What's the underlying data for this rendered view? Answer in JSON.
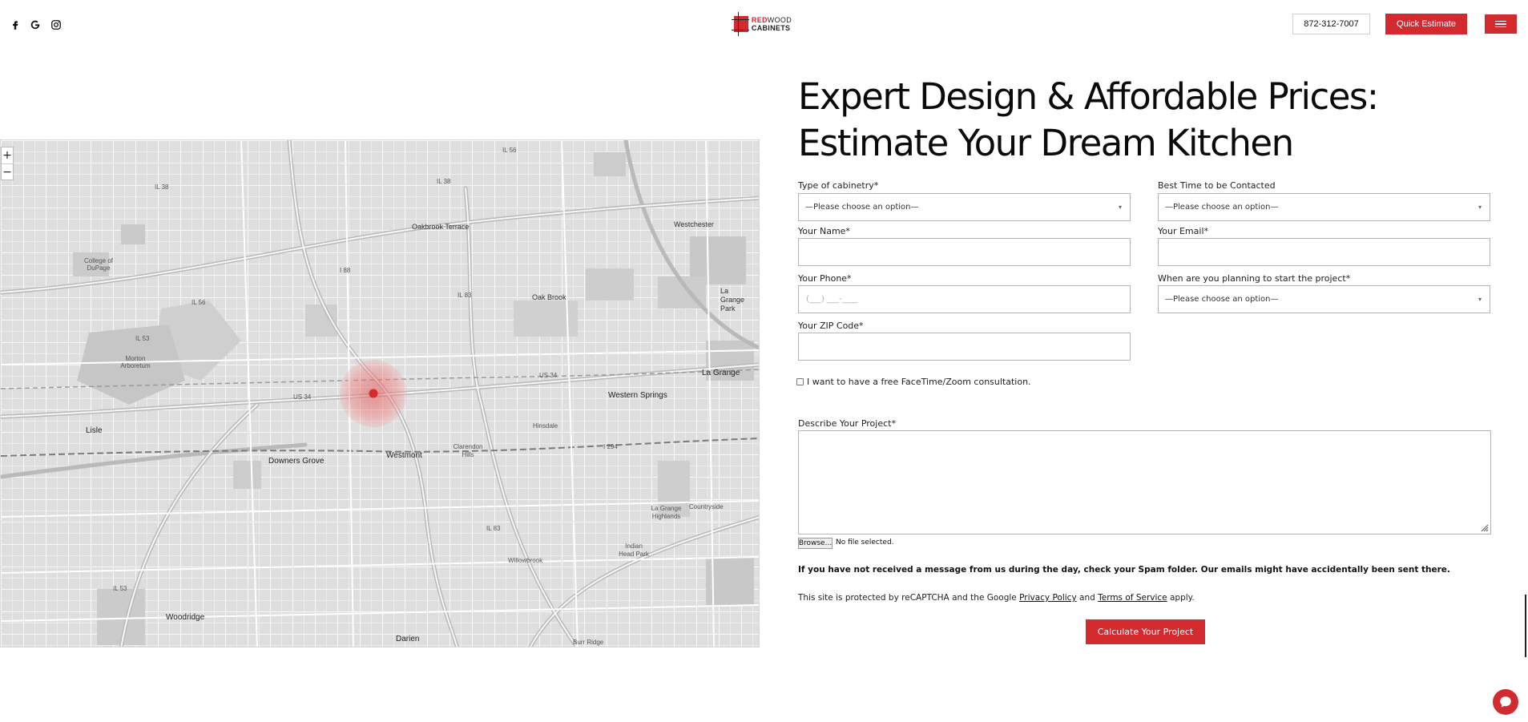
{
  "header": {
    "social_icons": [
      "facebook-icon",
      "google-icon",
      "instagram-icon"
    ],
    "logo": {
      "line1_red": "RED",
      "line1_rest": "WOOD",
      "line2": "CABINETS"
    },
    "phone": "872-312-7007",
    "quick_estimate_label": "Quick Estimate",
    "menu_icon": "hamburger-icon"
  },
  "map": {
    "zoom_in": "+",
    "zoom_out": "−",
    "labels": {
      "oakbrook_terrace": "Oakbrook Terrace",
      "westchester": "Westchester",
      "college_dupage": "College of DuPage",
      "oak_brook": "Oak Brook",
      "la_grange_park": "La Grange Park",
      "morton_arboretum": "Morton Arboretum",
      "la_grange": "La Grange",
      "western_springs": "Western Springs",
      "lisle": "Lisle",
      "hinsdale": "Hinsdale",
      "downers_grove": "Downers Grove",
      "westmont": "Westmont",
      "clarendon_hills": "Clarendon Hills",
      "la_grange_highlands": "La Grange Highlands",
      "countryside": "Countryside",
      "willowbrook": "Willowbrook",
      "indian_head_park": "Indian Head Park",
      "woodridge": "Woodridge",
      "darien": "Darien",
      "burr_ridge": "Burr Ridge",
      "i88": "I 88",
      "us34": "US 34",
      "il83": "IL 83",
      "i294": "I 294",
      "il56": "IL 56",
      "il38": "IL 38",
      "il53": "IL 53"
    }
  },
  "form": {
    "headline_line1": "Expert Design & Affordable Prices:",
    "headline_line2": "Estimate Your Dream Kitchen",
    "cabinetry_label": "Type of cabinetry*",
    "cabinetry_value": "—Please choose an option—",
    "best_time_label": "Best Time to be Contacted",
    "best_time_value": "—Please choose an option—",
    "name_label": "Your Name*",
    "name_value": "",
    "email_label": "Your Email*",
    "email_value": "",
    "phone_label": "Your Phone*",
    "phone_placeholder": "(___) ___-____",
    "start_label": "When are you planning to start the project*",
    "start_value": "—Please choose an option—",
    "zip_label": "Your ZIP Code*",
    "zip_value": "",
    "consult_label": "I want to have a free FaceTime/Zoom consultation.",
    "consult_checked": false,
    "describe_label": "Describe Your Project*",
    "browse_label": "Browse...",
    "no_file_label": "No file selected.",
    "spam_notice": "If you have not received a message from us during the day, check your Spam folder. Our emails might have accidentally been sent there.",
    "recaptcha_prefix": "This site is protected by reCAPTCHA and the Google ",
    "privacy_link": "Privacy Policy",
    "recaptcha_and": " and ",
    "terms_link": "Terms of Service",
    "recaptcha_suffix": " apply.",
    "submit_label": "Calculate Your Project"
  },
  "chat": {
    "icon": "chat-bubble-icon"
  },
  "colors": {
    "accent": "#d22a2e",
    "map_bg": "#e2e2e2",
    "text": "#0a0a0a"
  }
}
